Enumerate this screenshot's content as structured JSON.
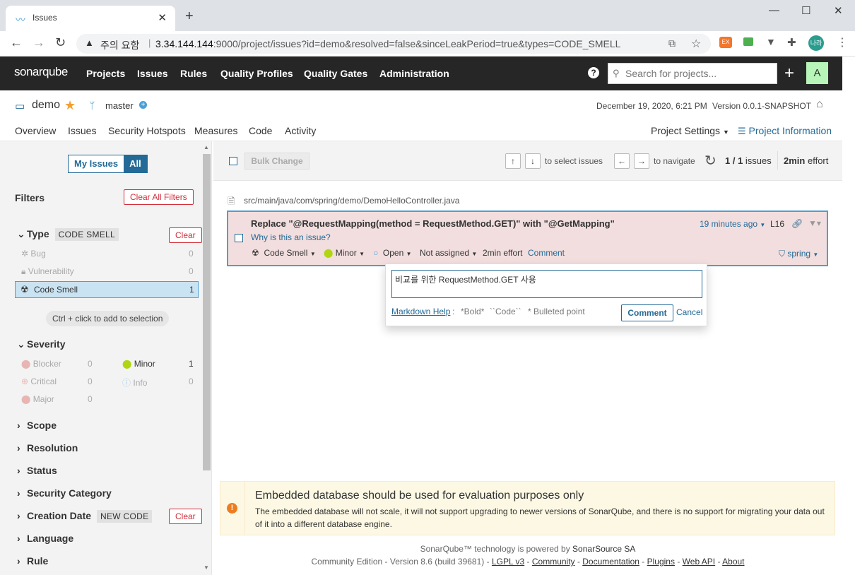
{
  "browser": {
    "tab_title": "Issues",
    "security_label": "주의 요함",
    "url_host": "3.34.144.144",
    "url_rest": ":9000/project/issues?id=demo&resolved=false&sinceLeakPeriod=true&types=CODE_SMELL",
    "profile_label": "나라",
    "ext_label": "EX"
  },
  "topnav": {
    "logo": "sonarqube",
    "items": [
      "Projects",
      "Issues",
      "Rules",
      "Quality Profiles",
      "Quality Gates",
      "Administration"
    ],
    "search_placeholder": "Search for projects...",
    "avatar": "A"
  },
  "project": {
    "name": "demo",
    "branch": "master",
    "date": "December 19, 2020, 6:21 PM",
    "version": "Version 0.0.1-SNAPSHOT",
    "tabs": [
      "Overview",
      "Issues",
      "Security Hotspots",
      "Measures",
      "Code",
      "Activity"
    ],
    "settings": "Project Settings",
    "info": "Project Information"
  },
  "sidebar": {
    "my_issues": "My Issues",
    "all": "All",
    "filters_title": "Filters",
    "clear_all": "Clear All Filters",
    "clear": "Clear",
    "type": {
      "title": "Type",
      "tag": "CODE SMELL",
      "items": [
        {
          "label": "Bug",
          "count": "0"
        },
        {
          "label": "Vulnerability",
          "count": "0"
        },
        {
          "label": "Code Smell",
          "count": "1"
        }
      ]
    },
    "hint": "Ctrl + click to add to selection",
    "severity": {
      "title": "Severity",
      "left": [
        {
          "label": "Blocker",
          "count": "0"
        },
        {
          "label": "Critical",
          "count": "0"
        },
        {
          "label": "Major",
          "count": "0"
        }
      ],
      "right": [
        {
          "label": "Minor",
          "count": "1"
        },
        {
          "label": "Info",
          "count": "0"
        }
      ]
    },
    "facets": [
      "Scope",
      "Resolution",
      "Status",
      "Security Category"
    ],
    "creation_date": {
      "title": "Creation Date",
      "tag": "NEW CODE"
    },
    "more_facets": [
      "Language",
      "Rule"
    ]
  },
  "toolbar": {
    "bulk_change": "Bulk Change",
    "select_hint": "to select issues",
    "nav_hint": "to navigate",
    "count": "1 / 1",
    "count_suffix": "issues",
    "effort": "2min",
    "effort_suffix": "effort"
  },
  "issue": {
    "file_path": "src/main/java/com/spring/demo/DemoHelloController.java",
    "message": "Replace \"@RequestMapping(method = RequestMethod.GET)\" with \"@GetMapping\"",
    "why": "Why is this an issue?",
    "age": "19 minutes ago",
    "line": "L16",
    "type": "Code Smell",
    "severity": "Minor",
    "status": "Open",
    "assignee": "Not assigned",
    "effort": "2min effort",
    "comment_link": "Comment",
    "tag": "spring"
  },
  "comment_popup": {
    "text": "비교를 위한 RequestMethod.GET 사용",
    "markdown_help": "Markdown Help",
    "bold": "*Bold*",
    "code": "``Code``",
    "bullet": "* Bulleted point",
    "submit": "Comment",
    "cancel": "Cancel"
  },
  "db_warning": {
    "title": "Embedded database should be used for evaluation purposes only",
    "body": "The embedded database will not scale, it will not support upgrading to newer versions of SonarQube, and there is no support for migrating your data out of it into a different database engine."
  },
  "footer": {
    "line1_prefix": "SonarQube™ technology is powered by",
    "line1_link": "SonarSource SA",
    "edition": "Community Edition - Version 8.6 (build 39681) -",
    "links": [
      "LGPL v3",
      "Community",
      "Documentation",
      "Plugins",
      "Web API",
      "About"
    ]
  },
  "colors": {
    "accent": "#236a97",
    "issue_bg": "#f2dede",
    "danger": "#d02f3a",
    "minor_green": "#b0d513",
    "star": "#f4a02b"
  }
}
